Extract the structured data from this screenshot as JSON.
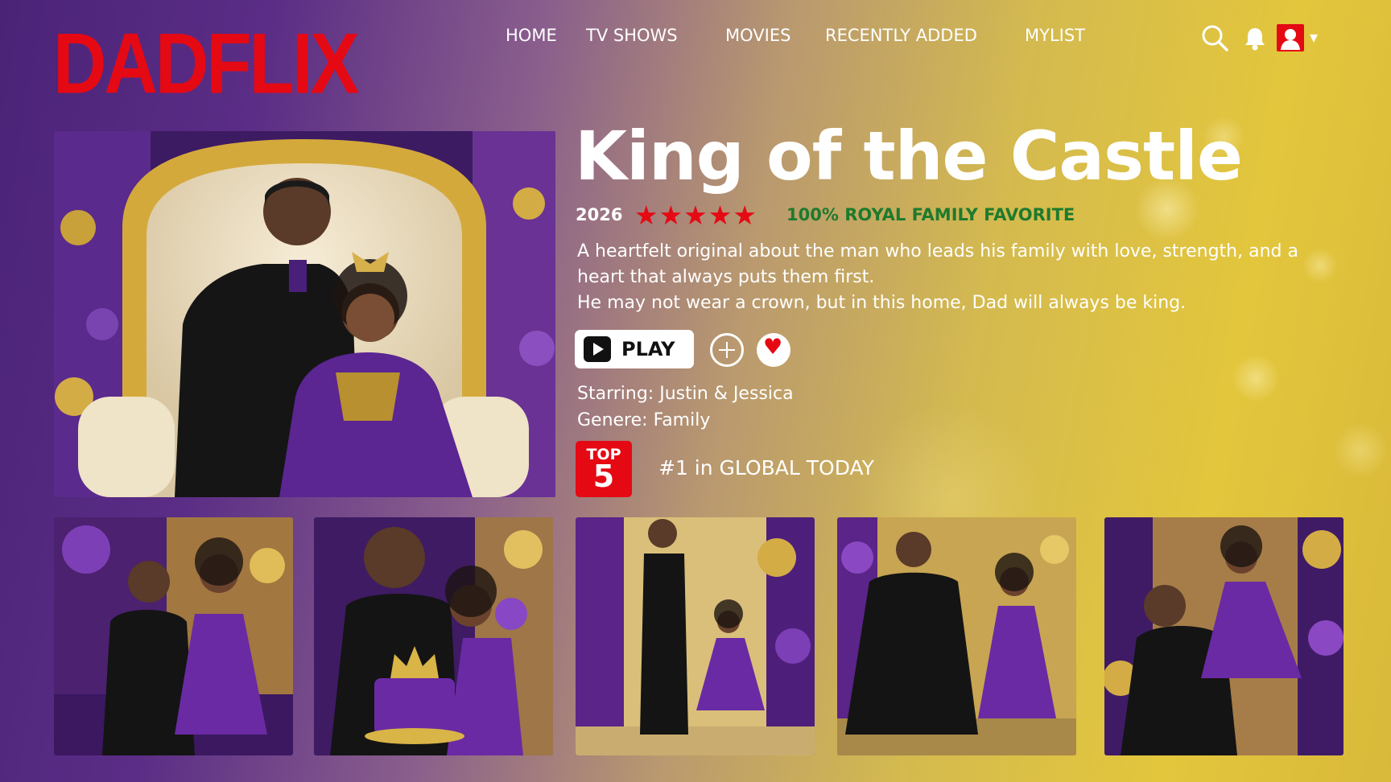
{
  "brand": {
    "logo_text": "DADFLIX",
    "accent_color": "#e50914"
  },
  "nav": {
    "items": [
      {
        "label": "HOME"
      },
      {
        "label": "TV SHOWS"
      },
      {
        "label": "MOVIES"
      },
      {
        "label": "RECENTLY ADDED"
      },
      {
        "label": "MYLIST"
      }
    ]
  },
  "header_icons": {
    "search": "search-icon",
    "notifications": "bell-icon",
    "profile": "profile-avatar-icon",
    "dropdown_caret": "▾"
  },
  "hero": {
    "image": "father-daughter-throne-photo",
    "title": "King of the Castle",
    "year": "2026",
    "rating_stars": "★★★★★",
    "rating_value": 5,
    "rating_max": 5,
    "favorite_text": "100% ROYAL FAMILY FAVORITE",
    "favorite_color": "#1e7a2d",
    "description": [
      "A heartfelt original about the man who leads his family with love, strength, and a heart that always puts them first.",
      "He may not wear a crown, but in this home, Dad will always be king."
    ],
    "play_label": "PLAY",
    "starring": "Starring: Justin & Jessica",
    "genre": "Genere: Family",
    "top_badge": {
      "line1": "TOP",
      "line2": "5"
    },
    "rank_text": "#1 in GLOBAL TODAY"
  },
  "thumbnails": [
    {
      "name": "thumb-sitting-together"
    },
    {
      "name": "thumb-crown-cake"
    },
    {
      "name": "thumb-holding-hands"
    },
    {
      "name": "thumb-high-five"
    },
    {
      "name": "thumb-lifting-daughter"
    }
  ]
}
